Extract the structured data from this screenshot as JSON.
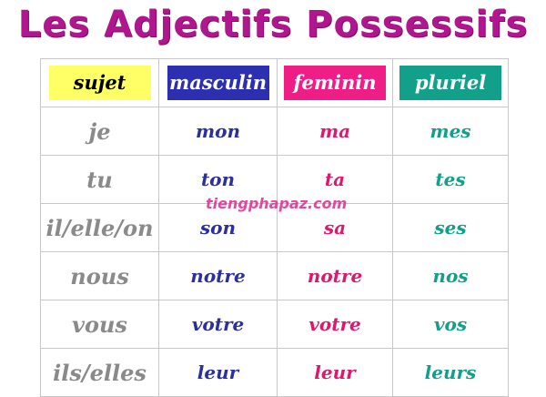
{
  "title": "Les Adjectifs Possessifs",
  "colors": {
    "title": "#b0168e",
    "sujet_bg": "#ffff66",
    "masculin_bg": "#2b2fb0",
    "feminin_bg": "#ee1e86",
    "pluriel_bg": "#12a08a",
    "pronoun_text": "#8a8a8a",
    "masc_text": "#2b2fa3",
    "fem_text": "#e0176c",
    "plur_text": "#12a08a"
  },
  "headers": {
    "sujet": "sujet",
    "masculin": "masculin",
    "feminin": "feminin",
    "pluriel": "pluriel"
  },
  "rows": [
    {
      "pronoun": "je",
      "masculin": "mon",
      "feminin": "ma",
      "pluriel": "mes"
    },
    {
      "pronoun": "tu",
      "masculin": "ton",
      "feminin": "ta",
      "pluriel": "tes"
    },
    {
      "pronoun": "il/elle/on",
      "masculin": "son",
      "feminin": "sa",
      "pluriel": "ses"
    },
    {
      "pronoun": "nous",
      "masculin": "notre",
      "feminin": "notre",
      "pluriel": "nos"
    },
    {
      "pronoun": "vous",
      "masculin": "votre",
      "feminin": "votre",
      "pluriel": "vos"
    },
    {
      "pronoun": "ils/elles",
      "masculin": "leur",
      "feminin": "leur",
      "pluriel": "leurs"
    }
  ],
  "watermark": "tiengphapaz.com"
}
